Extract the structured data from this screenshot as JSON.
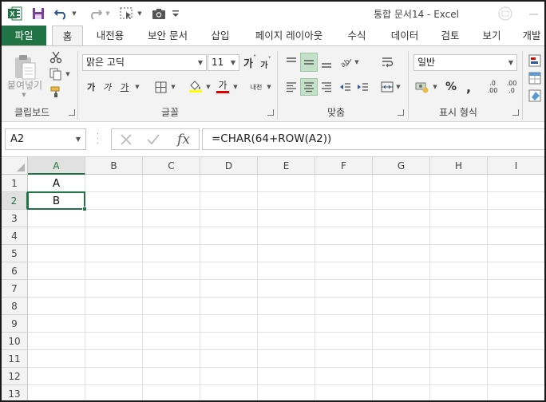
{
  "app": {
    "title": "통합 문서14 - Excel",
    "accent_color": "#217346",
    "icons": [
      "excel-logo-icon",
      "save-icon",
      "undo-icon",
      "redo-icon",
      "select-objects-icon",
      "camera-icon",
      "customize-qat-icon"
    ]
  },
  "tabs": {
    "file": "파일",
    "home": "홈",
    "insert_page": "내전용",
    "security": "보안 문서",
    "insert": "삽입",
    "page_layout": "페이지 레이아웃",
    "formulas": "수식",
    "data": "데이터",
    "review": "검토",
    "view": "보기",
    "developer": "개발"
  },
  "ribbon": {
    "clipboard": {
      "label": "클립보드",
      "paste": "붙여넣기"
    },
    "font": {
      "label": "글꼴",
      "font_name": "맑은 고딕",
      "font_size": "11",
      "grow": "가",
      "shrink": "가",
      "bold": "가",
      "italic": "가",
      "underline": "가",
      "font_color_glyph": "가",
      "phonetic": "내천"
    },
    "alignment": {
      "label": "맞춤"
    },
    "number": {
      "label": "표시 형식",
      "format": "일반",
      "percent": "%",
      "comma": ",",
      "inc_decimal": ".00",
      "dec_decimal": ".0"
    }
  },
  "formula_bar": {
    "name_box": "A2",
    "formula": "=CHAR(64+ROW(A2))",
    "fx": "fx"
  },
  "sheet": {
    "columns": [
      "A",
      "B",
      "C",
      "D",
      "E",
      "F",
      "G",
      "H",
      "I"
    ],
    "rows": [
      "1",
      "2",
      "3",
      "4",
      "5",
      "6",
      "7",
      "8",
      "9",
      "10",
      "11",
      "12",
      "13"
    ],
    "cells": {
      "A1": "A",
      "A2": "B"
    },
    "active_cell": "A2"
  }
}
